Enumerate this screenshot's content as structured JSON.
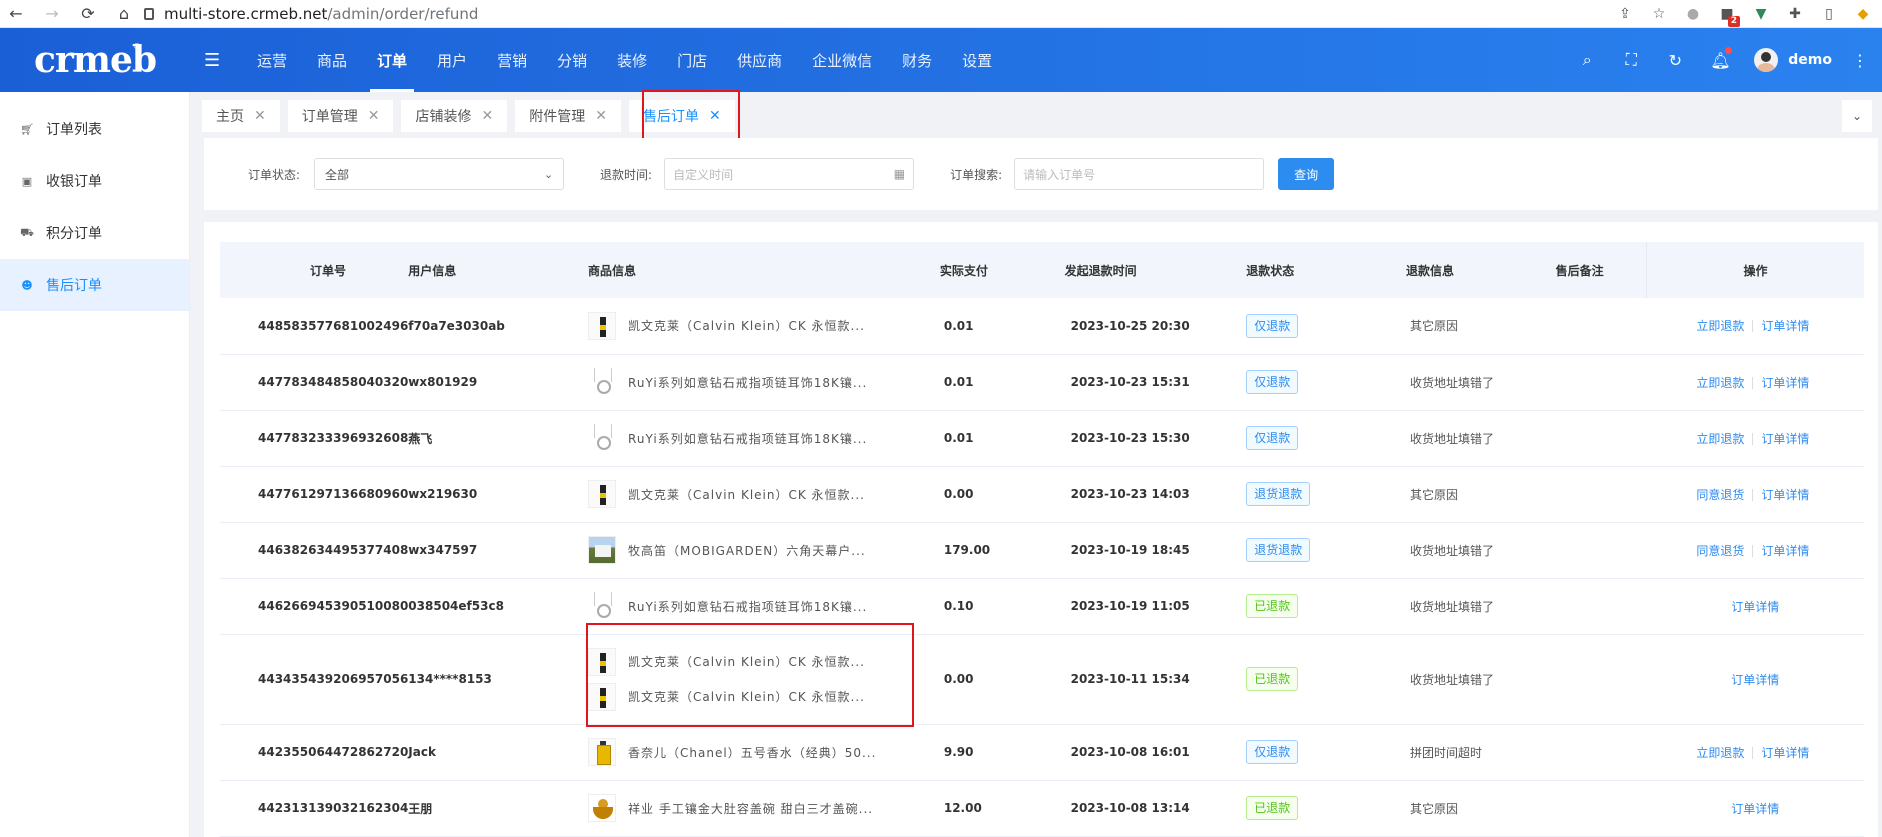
{
  "browser": {
    "url_host": "multi-store.crmeb.net",
    "url_path": "/admin/order/refund",
    "ext_badge": "2"
  },
  "header": {
    "logo": "crmeb",
    "nav": [
      "运营",
      "商品",
      "订单",
      "用户",
      "营销",
      "分销",
      "装修",
      "门店",
      "供应商",
      "企业微信",
      "财务",
      "设置"
    ],
    "active_nav": "订单",
    "user": "demo"
  },
  "sidebar": {
    "items": [
      {
        "label": "订单列表",
        "icon": "cart-icon"
      },
      {
        "label": "收银订单",
        "icon": "cash-icon"
      },
      {
        "label": "积分订单",
        "icon": "cart-outline-icon"
      },
      {
        "label": "售后订单",
        "icon": "service-icon",
        "active": true
      }
    ]
  },
  "tabs": [
    {
      "label": "主页"
    },
    {
      "label": "订单管理"
    },
    {
      "label": "店铺装修"
    },
    {
      "label": "附件管理"
    },
    {
      "label": "售后订单",
      "active": true
    }
  ],
  "filter": {
    "status_label": "订单状态:",
    "status_value": "全部",
    "time_label": "退款时间:",
    "time_placeholder": "自定义时间",
    "search_label": "订单搜索:",
    "search_placeholder": "请输入订单号",
    "query_btn": "查询"
  },
  "table": {
    "columns": [
      "订单号",
      "用户信息",
      "商品信息",
      "实际支付",
      "发起退款时间",
      "退款状态",
      "退款信息",
      "售后备注",
      "操作"
    ],
    "rows": [
      {
        "order": "448583577681002496",
        "user": "f70a7e3030ab",
        "goods": [
          {
            "thumb": "ck",
            "name": "凯文克莱（Calvin Klein）CK 永恒款..."
          }
        ],
        "pay": "0.01",
        "time": "2023-10-25 20:30",
        "status": "仅退款",
        "status_type": "blue",
        "info": "其它原因",
        "ops": [
          "立即退款",
          "订单详情"
        ]
      },
      {
        "order": "447783484858040320",
        "user": "wx801929",
        "goods": [
          {
            "thumb": "ruyi",
            "name": "RuYi系列如意钻石戒指项链耳饰18K镶..."
          }
        ],
        "pay": "0.01",
        "time": "2023-10-23 15:31",
        "status": "仅退款",
        "status_type": "blue",
        "info": "收货地址填错了",
        "ops": [
          "立即退款",
          "订单详情"
        ]
      },
      {
        "order": "447783233396932608",
        "user": "燕飞",
        "goods": [
          {
            "thumb": "ruyi",
            "name": "RuYi系列如意钻石戒指项链耳饰18K镶..."
          }
        ],
        "pay": "0.01",
        "time": "2023-10-23 15:30",
        "status": "仅退款",
        "status_type": "blue",
        "info": "收货地址填错了",
        "ops": [
          "立即退款",
          "订单详情"
        ]
      },
      {
        "order": "447761297136680960",
        "user": "wx219630",
        "goods": [
          {
            "thumb": "ck",
            "name": "凯文克莱（Calvin Klein）CK 永恒款..."
          }
        ],
        "pay": "0.00",
        "time": "2023-10-23 14:03",
        "status": "退货退款",
        "status_type": "blue",
        "info": "其它原因",
        "ops": [
          "同意退货",
          "订单详情"
        ]
      },
      {
        "order": "446382634495377408",
        "user": "wx347597",
        "goods": [
          {
            "thumb": "tent",
            "name": "牧高笛（MOBIGARDEN）六角天幕户..."
          }
        ],
        "pay": "179.00",
        "time": "2023-10-19 18:45",
        "status": "退货退款",
        "status_type": "blue",
        "info": "收货地址填错了",
        "ops": [
          "同意退货",
          "订单详情"
        ]
      },
      {
        "order": "446266945390510080",
        "user": "038504ef53c8",
        "goods": [
          {
            "thumb": "ruyi",
            "name": "RuYi系列如意钻石戒指项链耳饰18K镶..."
          }
        ],
        "pay": "0.10",
        "time": "2023-10-19 11:05",
        "status": "已退款",
        "status_type": "green",
        "info": "收货地址填错了",
        "ops": [
          "订单详情"
        ]
      },
      {
        "order": "443435439206957056",
        "user": "134****8153",
        "goods": [
          {
            "thumb": "ck",
            "name": "凯文克莱（Calvin Klein）CK 永恒款..."
          },
          {
            "thumb": "ck",
            "name": "凯文克莱（Calvin Klein）CK 永恒款..."
          }
        ],
        "pay": "0.00",
        "time": "2023-10-11 15:34",
        "status": "已退款",
        "status_type": "green",
        "info": "收货地址填错了",
        "ops": [
          "订单详情"
        ]
      },
      {
        "order": "442355064472862720",
        "user": "Jack",
        "goods": [
          {
            "thumb": "chanel",
            "name": "香奈儿（Chanel）五号香水（经典）50..."
          }
        ],
        "pay": "9.90",
        "time": "2023-10-08 16:01",
        "status": "仅退款",
        "status_type": "blue",
        "info": "拼团时间超时",
        "ops": [
          "立即退款",
          "订单详情"
        ]
      },
      {
        "order": "442313139032162304",
        "user": "王朋",
        "goods": [
          {
            "thumb": "bowl",
            "name": "祥业 手工镶金大肚容盖碗 甜白三才盖碗..."
          }
        ],
        "pay": "12.00",
        "time": "2023-10-08 13:14",
        "status": "已退款",
        "status_type": "green",
        "info": "其它原因",
        "ops": [
          "订单详情"
        ]
      }
    ]
  }
}
